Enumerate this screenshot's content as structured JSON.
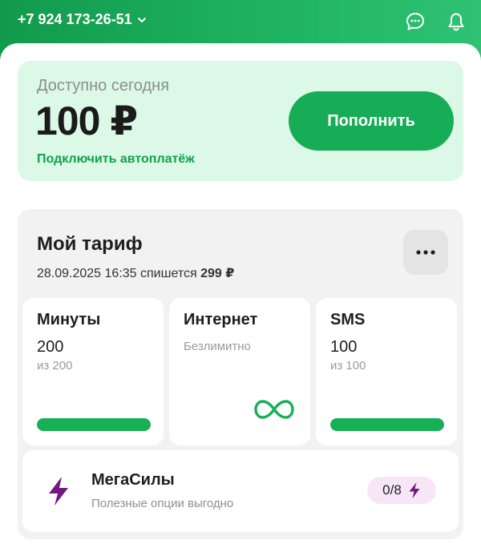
{
  "header": {
    "phone": "+7 924 173-26-51",
    "icons": [
      "chat-icon",
      "bell-icon"
    ]
  },
  "balance": {
    "label": "Доступно сегодня",
    "amount": "100 ₽",
    "autopay_link": "Подключить автоплатёж",
    "topup_label": "Пополнить"
  },
  "tariff": {
    "title": "Мой тариф",
    "charge_prefix": "28.09.2025 16:35 спишется",
    "charge_amount": "299 ₽",
    "more_icon": "more-dots-icon",
    "minutes": {
      "title": "Минуты",
      "value": "200",
      "total": "из 200",
      "remaining_fraction": 1.0
    },
    "internet": {
      "title": "Интернет",
      "note": "Безлимитно",
      "icon": "infinity-icon"
    },
    "sms": {
      "title": "SMS",
      "value": "100",
      "total": "из 100",
      "remaining_fraction": 1.0
    }
  },
  "megasily": {
    "title": "МегаСилы",
    "subtitle": "Полезные опции выгодно",
    "count": "0/8",
    "icon": "lightning-bolt-icon"
  },
  "colors": {
    "brand_green": "#17ad56",
    "light_green_bg": "#dcf8e6",
    "card_gray": "#f2f2f2",
    "purple_accent": "#731982",
    "badge_pink": "#f7e6f7"
  }
}
